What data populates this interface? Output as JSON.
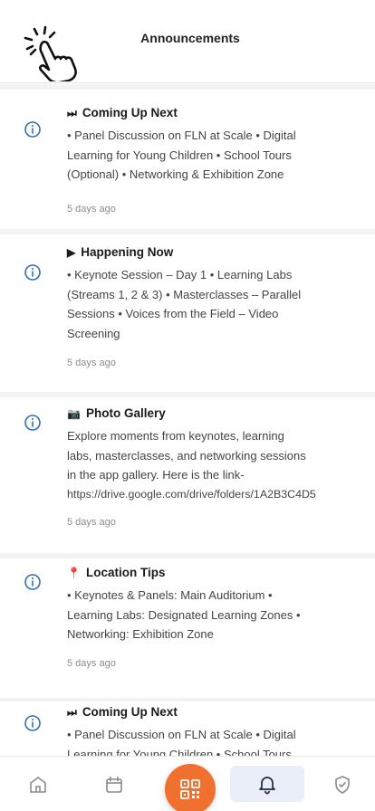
{
  "header": {
    "title": "Announcements",
    "tap_icon": "tap-hand-icon"
  },
  "colors": {
    "accent": "#f07030",
    "info_icon": "#2f6fb3",
    "active_tab_bg": "#e9eef8"
  },
  "announcements": [
    {
      "icon": "info-icon",
      "emoji": "⏭",
      "title": "Coming Up Next",
      "body": [
        "• Panel Discussion on FLN at Scale • Digital",
        "Learning for Young Children • School Tours",
        "(Optional) • Networking & Exhibition Zone"
      ],
      "time": "5 days ago"
    },
    {
      "icon": "info-icon",
      "emoji": "▶",
      "title": "Happening Now",
      "body": [
        "• Keynote Session – Day 1 • Learning Labs",
        "(Streams 1, 2 & 3) • Masterclasses – Parallel",
        "Sessions • Voices from the Field – Video",
        "Screening"
      ],
      "time": "5 days ago"
    },
    {
      "icon": "info-icon",
      "emoji": "📷",
      "title": "Photo Gallery",
      "body": [
        "Explore moments from keynotes, learning",
        "labs, masterclasses, and networking sessions",
        "in the app gallery. Here is the link-",
        "https://drive.google.com/drive/folders/1A2B3C4D5"
      ],
      "time": "5 days ago"
    },
    {
      "icon": "info-icon",
      "emoji": "📍",
      "title": "Location Tips",
      "body": [
        "• Keynotes & Panels: Main Auditorium •",
        "Learning Labs: Designated Learning Zones •",
        "Networking: Exhibition Zone"
      ],
      "time": "5 days ago"
    },
    {
      "icon": "info-icon",
      "emoji": "⏭",
      "title": "Coming Up Next",
      "body": [
        "• Panel Discussion on FLN at Scale • Digital",
        "Learning for Young Children • School Tours"
      ],
      "time": ""
    }
  ],
  "bottom_nav": {
    "home_icon": "home-icon",
    "calendar_icon": "calendar-icon",
    "qr_icon": "qr-code-icon",
    "bell_icon": "bell-icon",
    "shield_icon": "shield-check-icon",
    "active": "bell"
  }
}
